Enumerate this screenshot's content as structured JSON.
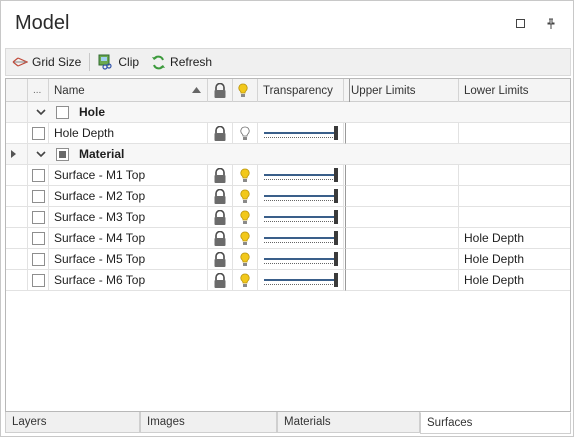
{
  "window": {
    "title": "Model"
  },
  "toolbar": {
    "grid_size_label": "Grid Size",
    "clip_label": "Clip",
    "refresh_label": "Refresh"
  },
  "grid": {
    "columns": {
      "indicator": "...",
      "name": "Name",
      "transparency": "Transparency",
      "upper_limits": "Upper Limits",
      "lower_limits": "Lower Limits"
    },
    "groups": [
      {
        "label": "Hole",
        "rows": [
          {
            "name": "Hole Depth",
            "upper": "",
            "lower": "",
            "visible": false
          }
        ]
      },
      {
        "label": "Material",
        "rows": [
          {
            "name": "Surface - M1 Top",
            "upper": "",
            "lower": "",
            "visible": true
          },
          {
            "name": "Surface - M2 Top",
            "upper": "",
            "lower": "",
            "visible": true
          },
          {
            "name": "Surface - M3 Top",
            "upper": "",
            "lower": "",
            "visible": true
          },
          {
            "name": "Surface - M4 Top",
            "upper": "",
            "lower": "Hole Depth",
            "visible": true
          },
          {
            "name": "Surface - M5 Top",
            "upper": "",
            "lower": "Hole Depth",
            "visible": true
          },
          {
            "name": "Surface - M6 Top",
            "upper": "",
            "lower": "Hole Depth",
            "visible": true
          }
        ]
      }
    ]
  },
  "tabs": [
    {
      "label": "Layers",
      "active": false
    },
    {
      "label": "Images",
      "active": false
    },
    {
      "label": "Materials",
      "active": false
    },
    {
      "label": "Surfaces",
      "active": true
    }
  ],
  "colors": {
    "bulb_on": "#f2c81b",
    "bulb_off": "#ffffff",
    "slider_track": "#3a5f8a"
  }
}
